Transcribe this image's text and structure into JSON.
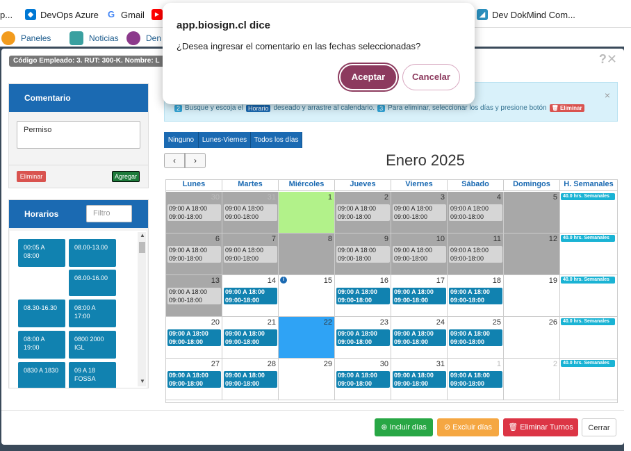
{
  "bookmarks": [
    {
      "label": "p...",
      "icon": "bookmark-icon"
    },
    {
      "label": "DevOps Azure",
      "icon": "azure-devops-icon"
    },
    {
      "label": "Gmail",
      "icon": "google-icon"
    },
    {
      "label": "",
      "icon": "youtube-icon"
    },
    {
      "label": "Dev DokMind Com...",
      "icon": "dokmind-icon"
    }
  ],
  "app_bar": {
    "paneles": "Paneles",
    "noticias": "Noticias",
    "den": "Den"
  },
  "modal": {
    "employee_label": "Código Empleado: 3. RUT: 300-K. Nombre: L",
    "close_icon": "?✕"
  },
  "comment_panel": {
    "title": "Comentario",
    "text": "Permiso",
    "eliminar": "Eliminar",
    "agregar": "Agregar"
  },
  "horarios_panel": {
    "title": "Horarios",
    "filter_placeholder": "Filtro",
    "items": [
      "00:05 A 08:00",
      "08.00-13.00",
      "08.00-16.00",
      "08.30-16.30",
      "08:00 A 17:00",
      "08:00 A 19:00",
      "0800 2000 IGL",
      "0830 A 1830",
      "09 A 18 FOSSA"
    ]
  },
  "alert": {
    "n2": "2",
    "text1": "Busque y escoja el",
    "horario_tag": "Horario",
    "text2": "deseado y arrastre al calendario.",
    "n3": "3",
    "text3": "Para eliminar, seleccionar los días y presione botón",
    "eliminar_tag": "🗑 Eliminar",
    "close": "×"
  },
  "toggles": [
    "Ninguno",
    "Lunes-Viernes",
    "Todos los días"
  ],
  "calendar": {
    "title": "Enero 2025",
    "prev": "‹",
    "next": "›",
    "headers": [
      "Lunes",
      "Martes",
      "Miércoles",
      "Jueves",
      "Viernes",
      "Sábado",
      "Domingos",
      "H. Semanales"
    ],
    "week_label": "40.0 hrs. Semanales",
    "shift_line1": "09:00 A 18:00",
    "shift_line2": "09:00-18:00",
    "rows": [
      {
        "days": [
          "30",
          "31",
          "1",
          "2",
          "3",
          "4",
          "5"
        ]
      },
      {
        "days": [
          "6",
          "7",
          "8",
          "9",
          "10",
          "11",
          "12"
        ]
      },
      {
        "days": [
          "13",
          "14",
          "15",
          "16",
          "17",
          "18",
          "19"
        ]
      },
      {
        "days": [
          "20",
          "21",
          "22",
          "23",
          "24",
          "25",
          "26"
        ]
      },
      {
        "days": [
          "27",
          "28",
          "29",
          "30",
          "31",
          "1",
          "2"
        ]
      }
    ]
  },
  "footer": {
    "incluir": "⊕ Incluir días",
    "excluir": "⊘ Excluir días",
    "eliminar_turnos": "🗑 Eliminar Turnos",
    "cerrar": "Cerrar"
  },
  "dialog": {
    "title": "app.biosign.cl dice",
    "message": "¿Desea ingresar el comentario en las fechas seleccionadas?",
    "ok": "Aceptar",
    "cancel": "Cancelar"
  }
}
